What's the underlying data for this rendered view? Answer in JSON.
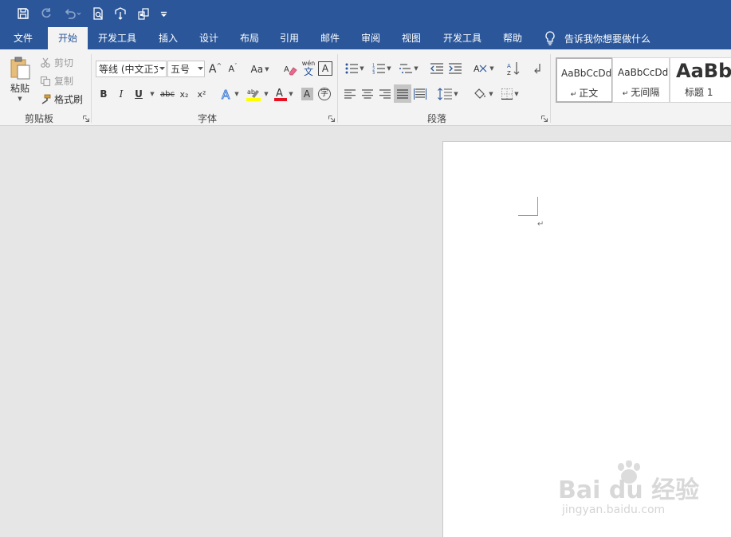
{
  "app": {
    "accent": "#2b579a",
    "ribbon_bg": "#f3f3f3",
    "workspace_bg": "#e6e6e6"
  },
  "qat": {
    "icons": [
      "save-icon",
      "redo-icon",
      "undo-icon",
      "print-preview-icon",
      "touch-mode-icon",
      "multi-page-icon",
      "customize-qat-icon"
    ]
  },
  "tabs": [
    {
      "label": "文件"
    },
    {
      "label": "开始"
    },
    {
      "label": "开发工具"
    },
    {
      "label": "插入"
    },
    {
      "label": "设计"
    },
    {
      "label": "布局"
    },
    {
      "label": "引用"
    },
    {
      "label": "邮件"
    },
    {
      "label": "审阅"
    },
    {
      "label": "视图"
    },
    {
      "label": "开发工具"
    },
    {
      "label": "帮助"
    }
  ],
  "active_tab": "开始",
  "tell_me": {
    "label": "告诉我你想要做什么"
  },
  "clipboard": {
    "paste_label": "粘贴",
    "cut_label": "剪切",
    "copy_label": "复制",
    "format_painter_label": "格式刷",
    "group_label": "剪贴板"
  },
  "font": {
    "font_name": "等线 (中文正文)",
    "font_size": "五号",
    "group_label": "字体",
    "change_case_label": "Aa",
    "bold": "B",
    "italic": "I",
    "underline": "U",
    "strike": "abc",
    "subscript": "x₂",
    "superscript": "x²",
    "phonetic": "wén",
    "phonetic_char": "文",
    "grow": "A",
    "shrink": "A",
    "char_border": "A",
    "char_shading": "A",
    "enclosed": "字"
  },
  "paragraph": {
    "group_label": "段落"
  },
  "styles": [
    {
      "sample": "AaBbCcDd",
      "name": "正文"
    },
    {
      "sample": "AaBbCcDd",
      "name": "无间隔"
    },
    {
      "sample": "AaBb",
      "name": "标题 1"
    }
  ],
  "document": {
    "paragraph_mark": "↵"
  },
  "watermark": {
    "main": "Bai du 经验",
    "sub": "jingyan.baidu.com"
  }
}
